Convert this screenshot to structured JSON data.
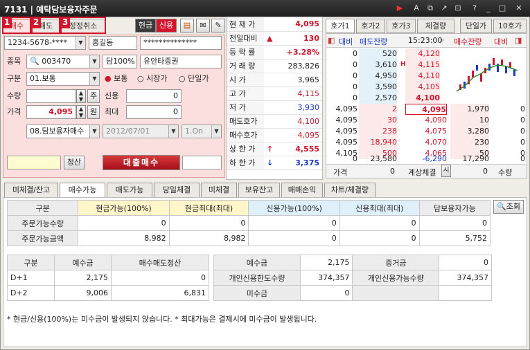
{
  "window": {
    "code": "7131",
    "title": "예탁담보융자주문"
  },
  "order_tabs": [
    {
      "badge": "1",
      "label": "매수"
    },
    {
      "badge": "2",
      "label": "매도"
    },
    {
      "badge": "3",
      "label": "정정취소"
    }
  ],
  "mode": {
    "cash": "현금",
    "credit": "신용"
  },
  "account": {
    "number": "1234-5678-****",
    "name": "홍길동",
    "password": "**************"
  },
  "stock": {
    "label": "종목",
    "code": "003470",
    "ratio": "담100%",
    "name": "유안타증권"
  },
  "type": {
    "label": "구분",
    "value": "01.보통",
    "opts": [
      "보통",
      "시장가",
      "단일가"
    ]
  },
  "qty": {
    "label": "수량",
    "value": "",
    "btn": "주"
  },
  "price": {
    "label": "가격",
    "value": "4,095",
    "btn": "원"
  },
  "credit": {
    "label": "신용",
    "value": "0"
  },
  "max": {
    "label": "최대",
    "value": "0"
  },
  "loan": {
    "type": "08.담보융자매수",
    "date": "2012/07/01",
    "term": "1.On"
  },
  "settle_btn": "정산",
  "submit_btn": "대출매수",
  "quote": [
    {
      "k": "현 재 가",
      "v": "4,095",
      "c": "red"
    },
    {
      "k": "전일대비",
      "v": "130",
      "c": "red",
      "arrow": "▲"
    },
    {
      "k": "등 락 률",
      "v": "+3.28%",
      "c": "red"
    },
    {
      "k": "거 래 량",
      "v": "283,826",
      "c": ""
    },
    {
      "k": "시    가",
      "v": "3,965",
      "c": ""
    },
    {
      "k": "고    가",
      "v": "4,115",
      "c": "red"
    },
    {
      "k": "저    가",
      "v": "3,930",
      "c": "blue"
    },
    {
      "k": "매도호가",
      "v": "4,100",
      "c": "red"
    },
    {
      "k": "매수호가",
      "v": "4,095",
      "c": "red"
    },
    {
      "k": "상 한 가",
      "v": "4,555",
      "c": "red",
      "arrow": "↑"
    },
    {
      "k": "하 한 가",
      "v": "3,375",
      "c": "blue",
      "arrow": "↓"
    }
  ],
  "ob_tabs": [
    "호가1",
    "호가2",
    "호가3",
    "체결량",
    "단일가",
    "10호가"
  ],
  "ob_head": {
    "left": "대비",
    "mid": "매도잔량",
    "time": "15:23:00",
    "right": "매수잔량",
    "right2": "대비"
  },
  "asks": [
    [
      "0",
      "520",
      "4,120"
    ],
    [
      "0",
      "3,610",
      "4,115"
    ],
    [
      "0",
      "4,950",
      "4,110"
    ],
    [
      "0",
      "3,590",
      "4,105"
    ],
    [
      "0",
      "2,570",
      "4,100"
    ]
  ],
  "bids": [
    [
      "4,095",
      "2",
      "4,095",
      "1,970",
      "0"
    ],
    [
      "4,095",
      "30",
      "4,090",
      "10",
      "0"
    ],
    [
      "4,095",
      "238",
      "4,075",
      "3,280",
      "0"
    ],
    [
      "4,095",
      "18,940",
      "4,070",
      "230",
      "0"
    ],
    [
      "4,105",
      "500",
      "4,065",
      "50",
      "0"
    ]
  ],
  "ob_total": [
    "0",
    "23,580",
    "-6,290",
    "17,290",
    "0"
  ],
  "ob_foot": {
    "price": "가격",
    "pv": "0",
    "calc": "계상체결",
    "sv": "시",
    "qv": "0",
    "qty": "수량"
  },
  "ob_h": "H",
  "bottom_tabs": [
    "미체결/잔고",
    "매수가능",
    "매도가능",
    "당일체결",
    "미체결",
    "보유잔고",
    "매매손익",
    "차트/체결량"
  ],
  "query_btn": "조회",
  "avail": {
    "head": [
      "구분",
      "현금가능(100%)",
      "현금최대(최대)",
      "신용가능(100%)",
      "신용최대(최대)",
      "담보융자가능"
    ],
    "rows": [
      [
        "주문가능수량",
        "0",
        "0",
        "0",
        "0",
        "0"
      ],
      [
        "주문가능금액",
        "8,982",
        "8,982",
        "0",
        "0",
        "5,752"
      ]
    ]
  },
  "dep": {
    "head": [
      "구분",
      "예수금",
      "매수매도정산"
    ],
    "rows": [
      [
        "D+1",
        "2,175",
        "0"
      ],
      [
        "D+2",
        "9,006",
        "6,831"
      ]
    ]
  },
  "dep2": {
    "rows": [
      [
        "예수금",
        "2,175",
        "증거금",
        "0"
      ],
      [
        "개인신용한도수량",
        "374,357",
        "개인신용가능수량",
        "374,357"
      ],
      [
        "미수금",
        "0",
        "",
        ""
      ]
    ]
  },
  "note": "* 현금/신용(100%)는 미수금이 발생되지 않습니다. * 최대가능은 결제시에 미수금이 발생됩니다."
}
